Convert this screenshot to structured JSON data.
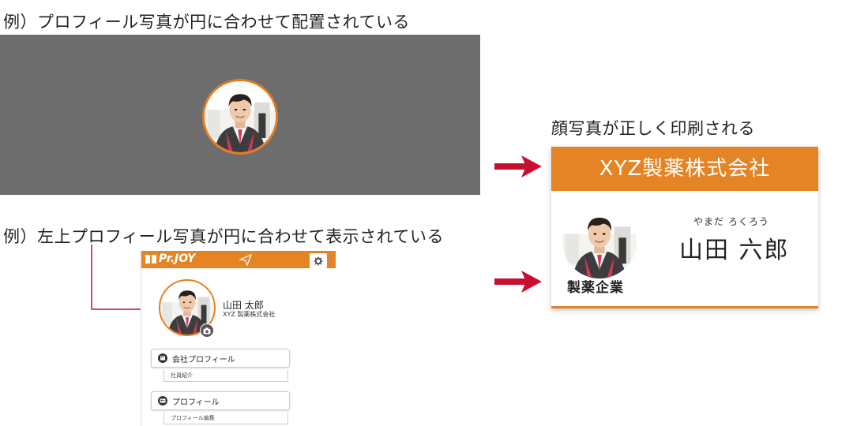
{
  "captions": {
    "top": "例）プロフィール写真が円に合わせて配置されている",
    "bottom": "例）左上プロフィール写真が円に合わせて表示されている",
    "right": "顔写真が正しく印刷される"
  },
  "badge": {
    "company": "XYZ製薬株式会社",
    "name_kana": "やまだ ろくろう",
    "name": "山田 六郎",
    "organization": "製薬企業"
  },
  "app": {
    "logo": "Pr.JOY",
    "user_name": "山田 太郎",
    "user_company": "XYZ 製薬株式会社",
    "menu": [
      {
        "label": "会社プロフィール",
        "icon": "building-icon",
        "sub": "社員紹介"
      },
      {
        "label": "プロフィール",
        "icon": "id-card-icon",
        "sub": "プロフィール編集"
      }
    ]
  },
  "colors": {
    "accent": "#e58424",
    "arrow": "#c8102e",
    "panel_gray": "#6d6d6d"
  }
}
